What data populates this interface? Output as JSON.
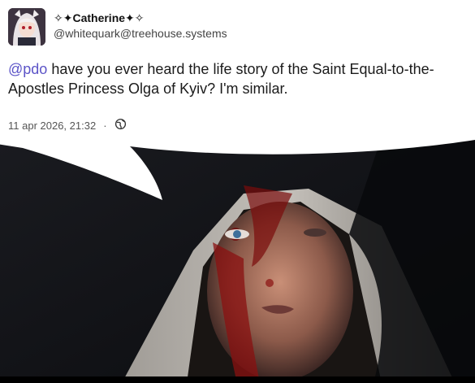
{
  "author": {
    "display_name": "✧✦Catherine✦✧",
    "handle": "@whitequark@treehouse.systems"
  },
  "post": {
    "mention": "@pdo",
    "text": " have you ever heard the life story of the Saint Equal-to-the-Apostles Princess Olga of Kyiv? I'm similar."
  },
  "meta": {
    "timestamp": "11 apr 2026, 21:32",
    "separator": "·",
    "visibility_icon": "globe-icon"
  },
  "image": {
    "icon": "speech-bubble-tail",
    "colors": {
      "background": "#101114",
      "blood": "#8a1010",
      "veil": "#d9d4cc"
    }
  }
}
